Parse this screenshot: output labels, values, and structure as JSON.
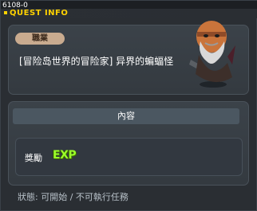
{
  "window": {
    "id_text": "6108-0",
    "title": "QUEST INFO"
  },
  "quest": {
    "job_tag": "職業",
    "name": "[冒险岛世界的冒险家] 异界的蝙蝠怪"
  },
  "content": {
    "header": "內容",
    "reward_label": "獎勵",
    "reward_icon_text": "EXP"
  },
  "status_text": "狀態: 可開始 / 不可執行任務",
  "colors": {
    "title": "#ffd200",
    "tag_bg": "#c9ab8f",
    "exp": "#9bff2a"
  },
  "icons": [
    "npc-portrait",
    "exp-icon"
  ]
}
